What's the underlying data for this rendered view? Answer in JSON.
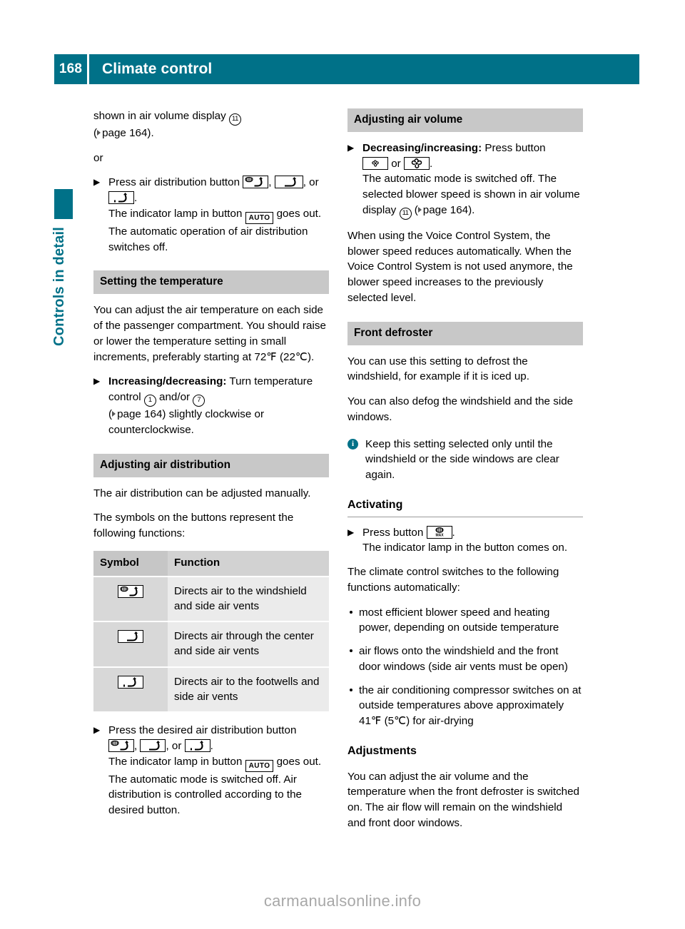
{
  "header": {
    "page_number": "168",
    "title": "Climate control"
  },
  "side_tab": {
    "label": "Controls in detail",
    "color": "#007188"
  },
  "icons": {
    "auto_button": "AUTO",
    "windshield_vent_button": "air-distribution-windshield-icon",
    "center_vent_button": "air-distribution-center-icon",
    "footwell_vent_button": "air-distribution-footwell-icon",
    "blower_decrease_button": "blower-decrease-icon",
    "blower_increase_button": "blower-increase-icon",
    "defroster_max_button": "defroster-max-icon",
    "info": "info-icon"
  },
  "left_column": {
    "intro": {
      "line1_pre": "shown in air volume display ",
      "line1_ref": "11",
      "line2_pre": "(",
      "line2_page": "page 164).",
      "or_label": "or"
    },
    "step_air_distribution": {
      "lead": "Press air distribution button ",
      "mid": ", ",
      "after_second": ", or",
      "period": ".",
      "result1_pre": "The indicator lamp in button ",
      "result1_post": " goes out.",
      "result2": "The automatic operation of air distribution switches off."
    },
    "setting_temperature": {
      "heading": "Setting the temperature",
      "body": "You can adjust the air temperature on each side of the passenger compartment. You should raise or lower the temperature setting in small increments, preferably starting at 72℉ (22℃).",
      "step_label": "Increasing/decreasing:",
      "step_text_pre": " Turn temperature control ",
      "ref_a": "1",
      "step_text_mid": " and/or ",
      "ref_b": "7",
      "step_text_post": "page 164) slightly clockwise or counterclockwise."
    },
    "adjusting_air_distribution": {
      "heading": "Adjusting air distribution",
      "para1": "The air distribution can be adjusted manually.",
      "para2": "The symbols on the buttons represent the following functions:",
      "table": {
        "columns": [
          "Symbol",
          "Function"
        ],
        "rows": [
          {
            "symbol": "air-distribution-windshield-icon",
            "function": "Directs air to the windshield and side air vents"
          },
          {
            "symbol": "air-distribution-center-icon",
            "function": "Directs air through the center and side air vents"
          },
          {
            "symbol": "air-distribution-footwell-icon",
            "function": "Directs air to the footwells and side air vents"
          }
        ]
      },
      "step": {
        "lead": "Press the desired air distribution button",
        "sep1": ", ",
        "sep2": ", or ",
        "period": ".",
        "result1_pre": "The indicator lamp in button ",
        "result1_post": " goes out.",
        "result2": "The automatic mode is switched off. Air distribution is controlled according to the desired button."
      }
    }
  },
  "right_column": {
    "adjusting_air_volume": {
      "heading": "Adjusting air volume",
      "step_label": "Decreasing/increasing:",
      "step_text": " Press button",
      "or_label": " or ",
      "period": ".",
      "result1_a": "The automatic mode is switched off. The selected blower speed is shown in air volume display ",
      "ref": "11",
      "result1_b": " (",
      "result1_c": "page 164).",
      "para": "When using the Voice Control System, the blower speed reduces automatically. When the Voice Control System is not used anymore, the blower speed increases to the previously selected level."
    },
    "front_defroster": {
      "heading": "Front defroster",
      "para1": "You can use this setting to defrost the windshield, for example if it is iced up.",
      "para2": "You can also defog the windshield and the side windows.",
      "note": "Keep this setting selected only until the windshield or the side windows are clear again."
    },
    "activating": {
      "heading": "Activating",
      "step_lead": "Press button ",
      "step_period": ".",
      "result1": "The indicator lamp in the button comes on.",
      "result2": "The climate control switches to the following functions automatically:",
      "bullets": [
        "most efficient blower speed and heating power, depending on outside temperature",
        "air flows onto the windshield and the front door windows (side air vents must be open)",
        "the air conditioning compressor switches on at outside temperatures above approximately 41℉ (5℃) for air-drying"
      ]
    },
    "adjustments": {
      "heading": "Adjustments",
      "para": "You can adjust the air volume and the temperature when the front defroster is switched on. The air flow will remain on the windshield and front door windows."
    }
  },
  "watermark": "carmanualsonline.info"
}
